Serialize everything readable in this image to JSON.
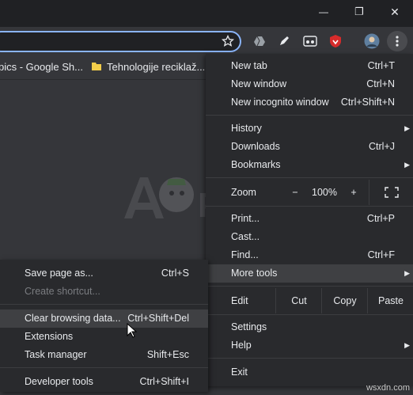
{
  "window": {
    "minimize_glyph": "—",
    "restore_glyph": "❐",
    "close_glyph": "✕"
  },
  "bookmarks": [
    {
      "label": "pics - Google Sh..."
    },
    {
      "label": "Tehnologije reciklaž..."
    }
  ],
  "menu": {
    "items_top": [
      {
        "label": "New tab",
        "shortcut": "Ctrl+T"
      },
      {
        "label": "New window",
        "shortcut": "Ctrl+N"
      },
      {
        "label": "New incognito window",
        "shortcut": "Ctrl+Shift+N"
      }
    ],
    "history": {
      "label": "History"
    },
    "downloads": {
      "label": "Downloads",
      "shortcut": "Ctrl+J"
    },
    "bookmarks": {
      "label": "Bookmarks"
    },
    "zoom": {
      "label": "Zoom",
      "minus": "−",
      "value": "100%",
      "plus": "+"
    },
    "print": {
      "label": "Print...",
      "shortcut": "Ctrl+P"
    },
    "cast": {
      "label": "Cast..."
    },
    "find": {
      "label": "Find...",
      "shortcut": "Ctrl+F"
    },
    "more_tools": {
      "label": "More tools"
    },
    "edit": {
      "label": "Edit",
      "cut": "Cut",
      "copy": "Copy",
      "paste": "Paste"
    },
    "settings": {
      "label": "Settings"
    },
    "help": {
      "label": "Help"
    },
    "exit": {
      "label": "Exit"
    }
  },
  "submenu": {
    "save_page": {
      "label": "Save page as...",
      "shortcut": "Ctrl+S"
    },
    "create_shortcut": {
      "label": "Create shortcut..."
    },
    "clear_data": {
      "label": "Clear browsing data...",
      "shortcut": "Ctrl+Shift+Del"
    },
    "extensions": {
      "label": "Extensions"
    },
    "task_manager": {
      "label": "Task manager",
      "shortcut": "Shift+Esc"
    },
    "developer_tools": {
      "label": "Developer tools",
      "shortcut": "Ctrl+Shift+I"
    }
  },
  "watermark": {
    "text": "A  PUALS"
  },
  "corner": {
    "text": "wsxdn.com"
  }
}
